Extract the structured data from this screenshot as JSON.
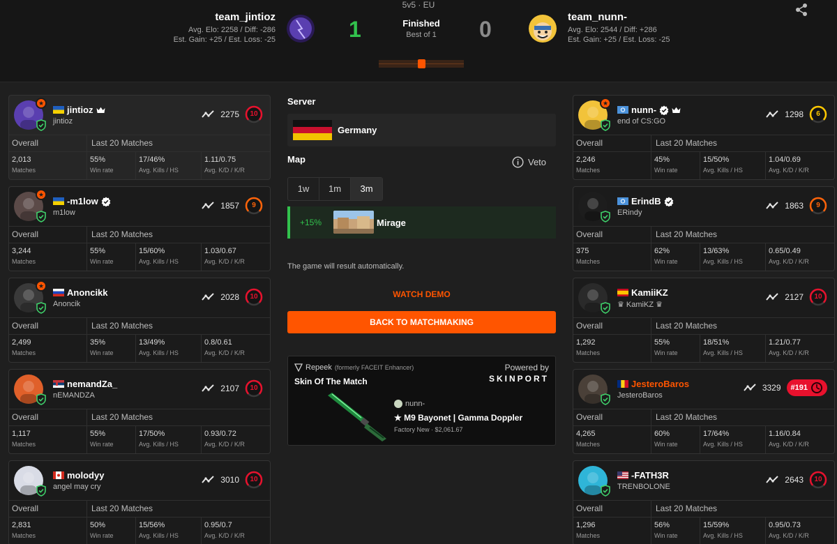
{
  "header": {
    "mode": "5v5 · EU",
    "status": "Finished",
    "format": "Best of 1",
    "team1": {
      "name": "team_jintioz",
      "stats1": "Avg. Elo: 2258 / Diff: -286",
      "stats2": "Est. Gain: +25 / Est. Loss: -25",
      "score": "1"
    },
    "team2": {
      "name": "team_nunn-",
      "stats1": "Avg. Elo: 2544 / Diff: +286",
      "stats2": "Est. Gain: +25 / Est. Loss: -25",
      "score": "0"
    }
  },
  "stat_labels": {
    "overall": "Overall",
    "last20": "Last 20 Matches",
    "matches": "Matches",
    "winrate": "Win rate",
    "kills": "Avg. Kills / HS",
    "kd": "Avg. K/D / K/R"
  },
  "left_players": [
    {
      "name": "jintioz",
      "sub": "jintioz",
      "elo": "2275",
      "level": "10",
      "matches": "2,013",
      "winrate": "55%",
      "kills": "17/46%",
      "kd": "1.11/0.75",
      "flag": "ukraine",
      "icons": [
        "crown-icon"
      ],
      "avatar_color": "#5a3fb0"
    },
    {
      "name": "-m1low",
      "sub": "m1low",
      "elo": "1857",
      "level": "9",
      "matches": "3,244",
      "winrate": "55%",
      "kills": "15/60%",
      "kd": "1.03/0.67",
      "flag": "ukraine",
      "icons": [
        "verified-icon"
      ],
      "avatar_color": "#5b4a48"
    },
    {
      "name": "Anoncikk",
      "sub": "Anoncik",
      "elo": "2028",
      "level": "10",
      "matches": "2,499",
      "winrate": "35%",
      "kills": "13/49%",
      "kd": "0.8/0.61",
      "flag": "russia",
      "icons": [],
      "avatar_color": "#3a3a3a"
    },
    {
      "name": "nemandZa_",
      "sub": "nEMANDZA",
      "elo": "2107",
      "level": "10",
      "matches": "1,117",
      "winrate": "55%",
      "kills": "17/50%",
      "kd": "0.93/0.72",
      "flag": "serbia",
      "icons": [],
      "avatar_color": "#e0602a"
    },
    {
      "name": "molodyy",
      "sub": "angel may cry",
      "elo": "3010",
      "level": "10",
      "matches": "2,831",
      "winrate": "50%",
      "kills": "15/56%",
      "kd": "0.95/0.7",
      "flag": "canada",
      "icons": [],
      "avatar_color": "#d9dce6"
    }
  ],
  "right_players": [
    {
      "name": "nunn-",
      "sub": "end of CS:GO",
      "elo": "1298",
      "level": "6",
      "matches": "2,246",
      "winrate": "45%",
      "kills": "15/50%",
      "kd": "1.04/0.69",
      "flag": "un",
      "icons": [
        "verified-icon",
        "crown-icon"
      ],
      "avatar_color": "#f2c33a"
    },
    {
      "name": "ErindB",
      "sub": "ERindy",
      "elo": "1863",
      "level": "9",
      "matches": "375",
      "winrate": "62%",
      "kills": "13/63%",
      "kd": "0.65/0.49",
      "flag": "un",
      "icons": [
        "verified-icon"
      ],
      "avatar_color": "#1d1d1d"
    },
    {
      "name": "KamiiKZ",
      "sub": "♛ KamiKZ ♛",
      "elo": "2127",
      "level": "10",
      "matches": "1,292",
      "winrate": "55%",
      "kills": "18/51%",
      "kd": "1.21/0.77",
      "flag": "spain",
      "icons": [],
      "avatar_color": "#2a2a2a"
    },
    {
      "name": "JesteroBaros",
      "sub": "JesteroBaros",
      "elo": "3329",
      "level": "#191",
      "matches": "4,265",
      "winrate": "60%",
      "kills": "17/64%",
      "kd": "1.16/0.84",
      "flag": "romania",
      "icons": [],
      "avatar_color": "#4a4038",
      "name_orange": true
    },
    {
      "name": "-FATH3R",
      "sub": "TRENBOLONE",
      "elo": "2643",
      "level": "10",
      "matches": "1,296",
      "winrate": "56%",
      "kills": "15/59%",
      "kd": "0.95/0.73",
      "flag": "usa",
      "icons": [],
      "avatar_color": "#2fb5d8"
    }
  ],
  "center": {
    "server_label": "Server",
    "server_name": "Germany",
    "map_label": "Map",
    "veto_label": "Veto",
    "tabs": [
      "1w",
      "1m",
      "3m"
    ],
    "active_tab": "3m",
    "map_pct": "+15%",
    "map_name": "Mirage",
    "auto_text": "The game will result automatically.",
    "watch_demo": "WATCH DEMO",
    "back_btn": "BACK TO MATCHMAKING"
  },
  "sotm": {
    "brand_line": "Repeek",
    "brand_note": "(formerly FACEIT Enhancer)",
    "title": "Skin Of The Match",
    "powered": "Powered by",
    "sponsor": "SKINPORT",
    "owner": "nunn-",
    "item": "★ M9 Bayonet | Gamma Doppler",
    "condition": "Factory New · $2,061.67"
  },
  "colors": {
    "accent": "#ff5500",
    "win": "#32c24d",
    "loss": "#8a8a8a",
    "level10": "#e8112d",
    "level9": "#ff6309",
    "level6": "#ffc800",
    "verified": "#ffffff"
  }
}
